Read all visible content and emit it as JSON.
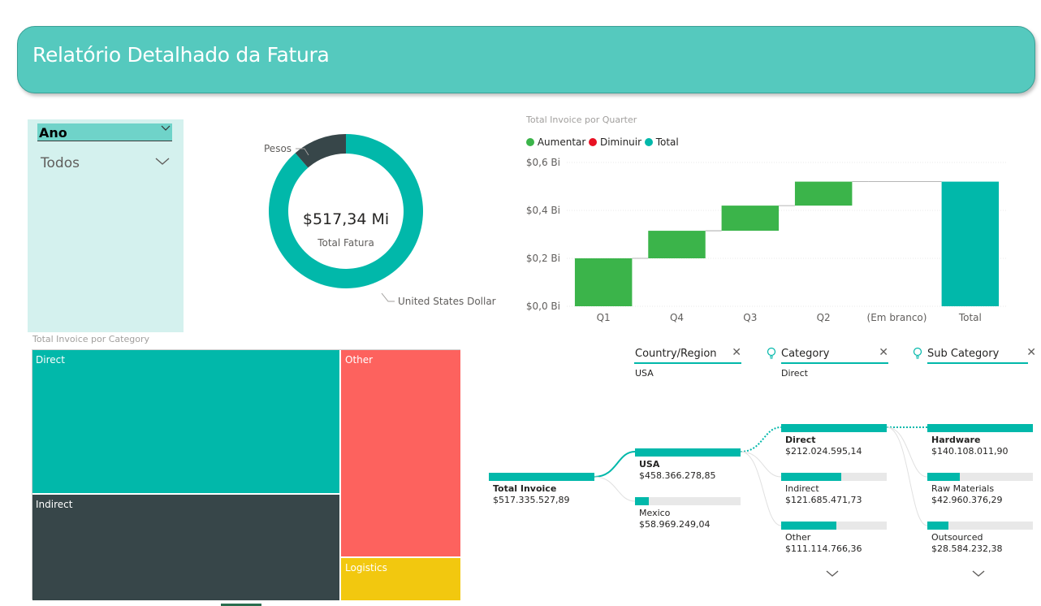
{
  "header": {
    "title": "Relatório Detalhado da Fatura"
  },
  "slicer": {
    "title": "Ano",
    "value": "Todos"
  },
  "donut": {
    "center_value": "$517,34 Mi",
    "center_label": "Total Fatura",
    "label_small": "Pesos",
    "label_large": "United States Dollar",
    "colors": {
      "large": "#01b8aa",
      "small": "#374649"
    }
  },
  "waterfall": {
    "title": "Total Invoice por Quarter",
    "legend": [
      {
        "label": "Aumentar",
        "color": "#3bb44a"
      },
      {
        "label": "Diminuir",
        "color": "#e81123"
      },
      {
        "label": "Total",
        "color": "#01b8aa"
      }
    ],
    "y_ticks": [
      "$0,6 Bi",
      "$0,4 Bi",
      "$0,2 Bi",
      "$0,0 Bi"
    ]
  },
  "treemap": {
    "title": "Total Invoice por Category",
    "items": [
      {
        "label": "Direct",
        "color": "#01b8aa"
      },
      {
        "label": "Indirect",
        "color": "#374649"
      },
      {
        "label": "Other",
        "color": "#fd625e"
      },
      {
        "label": "Logistics",
        "color": "#f2c80f"
      }
    ]
  },
  "decomposition": {
    "headers": [
      {
        "label": "Country/Region",
        "selected": "USA"
      },
      {
        "label": "Category",
        "selected": "Direct"
      },
      {
        "label": "Sub Category"
      }
    ],
    "root": {
      "label": "Total Invoice",
      "value": "$517.335.527,89"
    },
    "country": [
      {
        "label": "USA",
        "value": "$458.366.278,85"
      },
      {
        "label": "Mexico",
        "value": "$58.969.249,04"
      }
    ],
    "category": [
      {
        "label": "Direct",
        "value": "$212.024.595,14"
      },
      {
        "label": "Indirect",
        "value": "$121.685.471,73"
      },
      {
        "label": "Other",
        "value": "$111.114.766,36"
      }
    ],
    "subcategory": [
      {
        "label": "Hardware",
        "value": "$140.108.011,90"
      },
      {
        "label": "Raw Materials",
        "value": "$42.960.376,29"
      },
      {
        "label": "Outsourced",
        "value": "$28.584.232,38"
      }
    ]
  },
  "chart_data": [
    {
      "type": "pie",
      "hole": true,
      "categories": [
        "United States Dollar",
        "Pesos"
      ],
      "values": [
        458.37,
        58.97
      ],
      "annotations": [
        "$517,34 Mi",
        "Total Fatura"
      ]
    },
    {
      "type": "bar",
      "subtype": "waterfall",
      "title": "Total Invoice por Quarter",
      "categories": [
        "Q1",
        "Q4",
        "Q3",
        "Q2",
        "(Em branco)",
        "Total"
      ],
      "series": [
        {
          "name": "Aumentar",
          "values": [
            0.2,
            0.115,
            0.105,
            0.1,
            0.0,
            null
          ]
        },
        {
          "name": "Total",
          "values": [
            null,
            null,
            null,
            null,
            null,
            0.52
          ]
        }
      ],
      "ylim": [
        0,
        0.6
      ],
      "legend": [
        "Aumentar",
        "Diminuir",
        "Total"
      ]
    },
    {
      "type": "heatmap",
      "subtype": "treemap",
      "title": "Total Invoice por Category",
      "categories": [
        "Direct",
        "Indirect",
        "Other",
        "Logistics"
      ],
      "values": [
        212.02,
        121.69,
        111.11,
        18.0
      ]
    }
  ]
}
